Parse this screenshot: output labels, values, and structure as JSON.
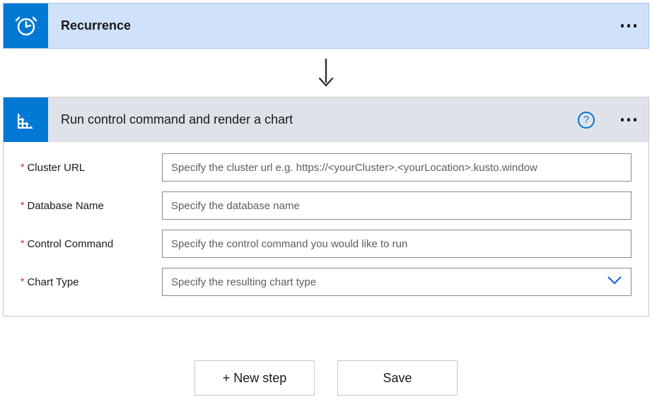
{
  "trigger": {
    "title": "Recurrence"
  },
  "action": {
    "title": "Run control command and render a chart"
  },
  "fields": {
    "clusterUrl": {
      "label": "Cluster URL",
      "placeholder": "Specify the cluster url e.g. https://<yourCluster>.<yourLocation>.kusto.window"
    },
    "databaseName": {
      "label": "Database Name",
      "placeholder": "Specify the database name"
    },
    "controlCommand": {
      "label": "Control Command",
      "placeholder": "Specify the control command you would like to run"
    },
    "chartType": {
      "label": "Chart Type",
      "placeholder": "Specify the resulting chart type"
    }
  },
  "footer": {
    "newStep": "+ New step",
    "save": "Save"
  },
  "help": "?"
}
